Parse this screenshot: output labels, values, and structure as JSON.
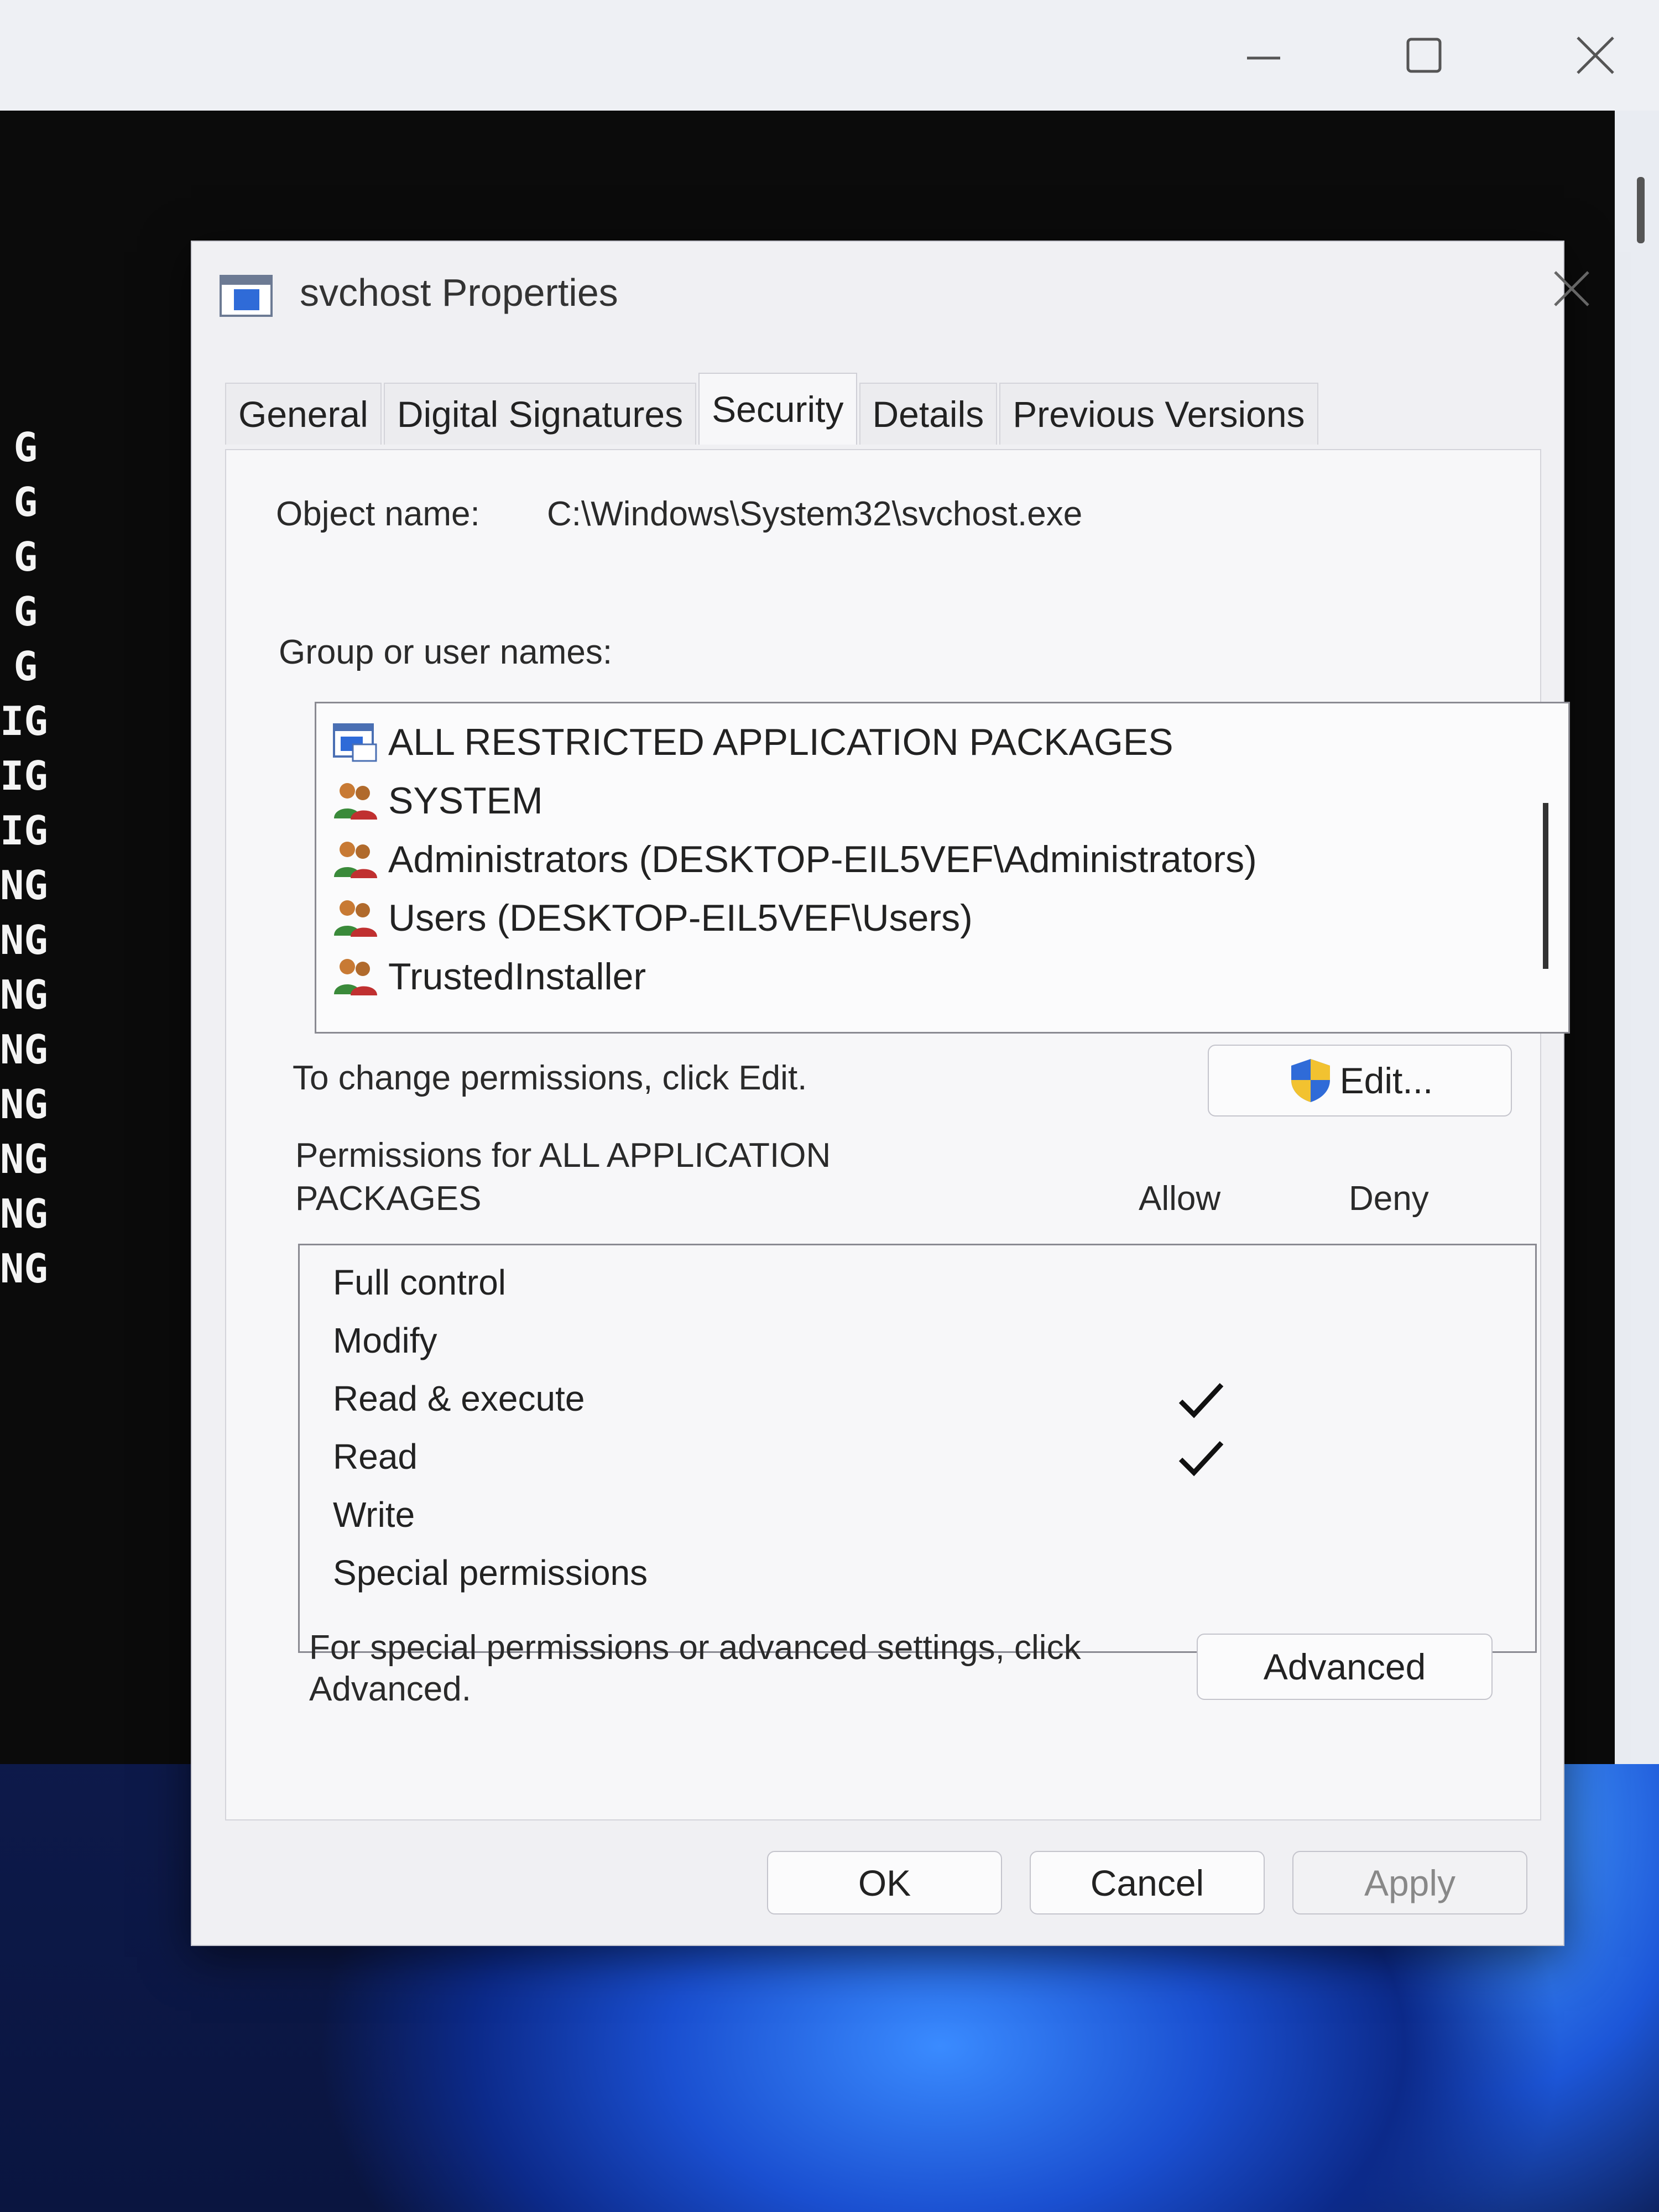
{
  "dialog": {
    "title": "svchost Properties",
    "tabs": [
      {
        "label": "General"
      },
      {
        "label": "Digital Signatures"
      },
      {
        "label": "Security"
      },
      {
        "label": "Details"
      },
      {
        "label": "Previous Versions"
      }
    ],
    "active_tab": "Security"
  },
  "security": {
    "object_name_label": "Object name:",
    "object_name_value": "C:\\Windows\\System32\\svchost.exe",
    "group_label": "Group or user names:",
    "groups": [
      {
        "name": "ALL RESTRICTED APPLICATION PACKAGES",
        "icon": "app-packages-icon"
      },
      {
        "name": "SYSTEM",
        "icon": "users-group-icon"
      },
      {
        "name": "Administrators (DESKTOP-EIL5VEF\\Administrators)",
        "icon": "users-group-icon"
      },
      {
        "name": "Users (DESKTOP-EIL5VEF\\Users)",
        "icon": "users-group-icon"
      },
      {
        "name": "TrustedInstaller",
        "icon": "users-group-icon"
      }
    ],
    "change_hint": "To change permissions, click Edit.",
    "edit_label": "Edit...",
    "permissions_for_line1": "Permissions for ALL APPLICATION",
    "permissions_for_line2": "PACKAGES",
    "allow_header": "Allow",
    "deny_header": "Deny",
    "permissions": [
      {
        "name": "Full control",
        "allow": false,
        "deny": false
      },
      {
        "name": "Modify",
        "allow": false,
        "deny": false
      },
      {
        "name": "Read & execute",
        "allow": true,
        "deny": false
      },
      {
        "name": "Read",
        "allow": true,
        "deny": false
      },
      {
        "name": "Write",
        "allow": false,
        "deny": false
      },
      {
        "name": "Special permissions",
        "allow": false,
        "deny": false
      }
    ],
    "advanced_hint_line1": "For special permissions or advanced settings, click",
    "advanced_hint_line2": "Advanced.",
    "advanced_label": "Advanced"
  },
  "footer": {
    "ok_label": "OK",
    "cancel_label": "Cancel",
    "apply_label": "Apply"
  },
  "background_console": {
    "lines": [
      "G",
      "G",
      "G",
      "G",
      "G",
      "IG",
      "IG",
      "IG",
      "NG",
      "NG",
      "NG",
      "NG",
      "NG",
      "NG",
      "NG",
      "NG"
    ]
  },
  "colors": {
    "dialog_bg": "#f0f0f3",
    "console_bg": "#0b0b0b",
    "shield_blue": "#2f6bd8",
    "shield_yellow": "#f2c230"
  }
}
